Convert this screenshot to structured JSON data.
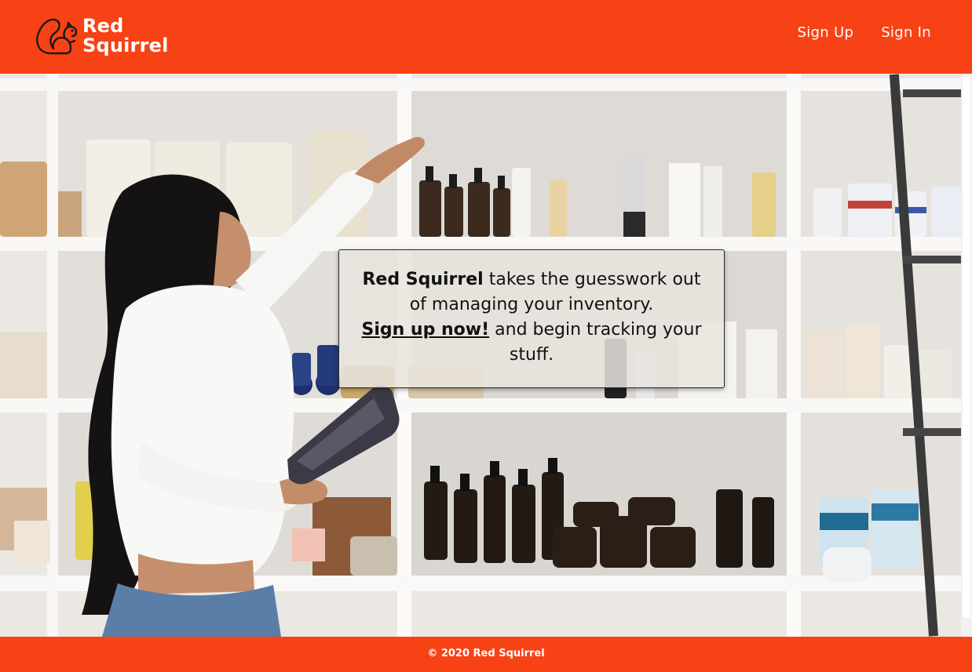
{
  "colors": {
    "brand": "#f74215",
    "header_text": "#ffffff",
    "callout_bg": "#e8e4de",
    "callout_text": "#111111"
  },
  "header": {
    "logo": {
      "icon": "squirrel-icon",
      "line1": "Red",
      "line2": "Squirrel"
    },
    "nav": {
      "sign_up": "Sign Up",
      "sign_in": "Sign In"
    }
  },
  "hero": {
    "image": "woman-stocking-shelves-with-tablet",
    "callout": {
      "brand": "Red Squirrel",
      "text_after_brand": "takes the guesswork out of managing your inventory.",
      "cta_link": "Sign up now!",
      "text_after_link": "and begin tracking your stuff."
    }
  },
  "footer": {
    "copyright": "© 2020 Red Squirrel"
  }
}
